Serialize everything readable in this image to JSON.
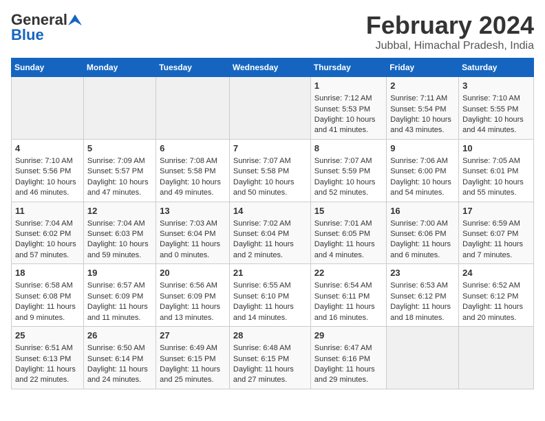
{
  "logo": {
    "part1": "General",
    "part2": "Blue"
  },
  "title": "February 2024",
  "subtitle": "Jubbal, Himachal Pradesh, India",
  "headers": [
    "Sunday",
    "Monday",
    "Tuesday",
    "Wednesday",
    "Thursday",
    "Friday",
    "Saturday"
  ],
  "weeks": [
    [
      {
        "day": "",
        "data": ""
      },
      {
        "day": "",
        "data": ""
      },
      {
        "day": "",
        "data": ""
      },
      {
        "day": "",
        "data": ""
      },
      {
        "day": "1",
        "data": "Sunrise: 7:12 AM\nSunset: 5:53 PM\nDaylight: 10 hours and 41 minutes."
      },
      {
        "day": "2",
        "data": "Sunrise: 7:11 AM\nSunset: 5:54 PM\nDaylight: 10 hours and 43 minutes."
      },
      {
        "day": "3",
        "data": "Sunrise: 7:10 AM\nSunset: 5:55 PM\nDaylight: 10 hours and 44 minutes."
      }
    ],
    [
      {
        "day": "4",
        "data": "Sunrise: 7:10 AM\nSunset: 5:56 PM\nDaylight: 10 hours and 46 minutes."
      },
      {
        "day": "5",
        "data": "Sunrise: 7:09 AM\nSunset: 5:57 PM\nDaylight: 10 hours and 47 minutes."
      },
      {
        "day": "6",
        "data": "Sunrise: 7:08 AM\nSunset: 5:58 PM\nDaylight: 10 hours and 49 minutes."
      },
      {
        "day": "7",
        "data": "Sunrise: 7:07 AM\nSunset: 5:58 PM\nDaylight: 10 hours and 50 minutes."
      },
      {
        "day": "8",
        "data": "Sunrise: 7:07 AM\nSunset: 5:59 PM\nDaylight: 10 hours and 52 minutes."
      },
      {
        "day": "9",
        "data": "Sunrise: 7:06 AM\nSunset: 6:00 PM\nDaylight: 10 hours and 54 minutes."
      },
      {
        "day": "10",
        "data": "Sunrise: 7:05 AM\nSunset: 6:01 PM\nDaylight: 10 hours and 55 minutes."
      }
    ],
    [
      {
        "day": "11",
        "data": "Sunrise: 7:04 AM\nSunset: 6:02 PM\nDaylight: 10 hours and 57 minutes."
      },
      {
        "day": "12",
        "data": "Sunrise: 7:04 AM\nSunset: 6:03 PM\nDaylight: 10 hours and 59 minutes."
      },
      {
        "day": "13",
        "data": "Sunrise: 7:03 AM\nSunset: 6:04 PM\nDaylight: 11 hours and 0 minutes."
      },
      {
        "day": "14",
        "data": "Sunrise: 7:02 AM\nSunset: 6:04 PM\nDaylight: 11 hours and 2 minutes."
      },
      {
        "day": "15",
        "data": "Sunrise: 7:01 AM\nSunset: 6:05 PM\nDaylight: 11 hours and 4 minutes."
      },
      {
        "day": "16",
        "data": "Sunrise: 7:00 AM\nSunset: 6:06 PM\nDaylight: 11 hours and 6 minutes."
      },
      {
        "day": "17",
        "data": "Sunrise: 6:59 AM\nSunset: 6:07 PM\nDaylight: 11 hours and 7 minutes."
      }
    ],
    [
      {
        "day": "18",
        "data": "Sunrise: 6:58 AM\nSunset: 6:08 PM\nDaylight: 11 hours and 9 minutes."
      },
      {
        "day": "19",
        "data": "Sunrise: 6:57 AM\nSunset: 6:09 PM\nDaylight: 11 hours and 11 minutes."
      },
      {
        "day": "20",
        "data": "Sunrise: 6:56 AM\nSunset: 6:09 PM\nDaylight: 11 hours and 13 minutes."
      },
      {
        "day": "21",
        "data": "Sunrise: 6:55 AM\nSunset: 6:10 PM\nDaylight: 11 hours and 14 minutes."
      },
      {
        "day": "22",
        "data": "Sunrise: 6:54 AM\nSunset: 6:11 PM\nDaylight: 11 hours and 16 minutes."
      },
      {
        "day": "23",
        "data": "Sunrise: 6:53 AM\nSunset: 6:12 PM\nDaylight: 11 hours and 18 minutes."
      },
      {
        "day": "24",
        "data": "Sunrise: 6:52 AM\nSunset: 6:12 PM\nDaylight: 11 hours and 20 minutes."
      }
    ],
    [
      {
        "day": "25",
        "data": "Sunrise: 6:51 AM\nSunset: 6:13 PM\nDaylight: 11 hours and 22 minutes."
      },
      {
        "day": "26",
        "data": "Sunrise: 6:50 AM\nSunset: 6:14 PM\nDaylight: 11 hours and 24 minutes."
      },
      {
        "day": "27",
        "data": "Sunrise: 6:49 AM\nSunset: 6:15 PM\nDaylight: 11 hours and 25 minutes."
      },
      {
        "day": "28",
        "data": "Sunrise: 6:48 AM\nSunset: 6:15 PM\nDaylight: 11 hours and 27 minutes."
      },
      {
        "day": "29",
        "data": "Sunrise: 6:47 AM\nSunset: 6:16 PM\nDaylight: 11 hours and 29 minutes."
      },
      {
        "day": "",
        "data": ""
      },
      {
        "day": "",
        "data": ""
      }
    ]
  ]
}
